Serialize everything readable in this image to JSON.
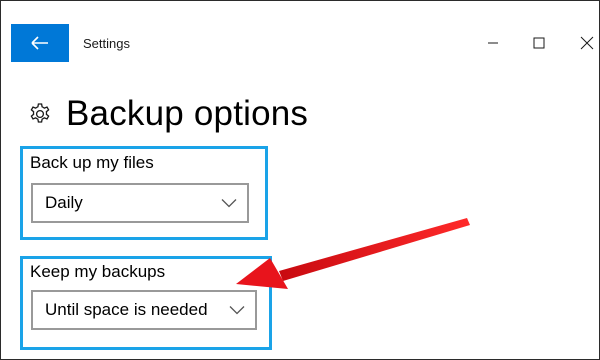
{
  "window": {
    "title": "Settings",
    "back_icon": "back-arrow-icon",
    "accent_color": "#0078d7",
    "controls": [
      "minimize-icon",
      "maximize-icon",
      "close-icon"
    ]
  },
  "page": {
    "title": "Backup options",
    "icon": "gear-icon"
  },
  "settings": {
    "backup_frequency": {
      "label": "Back up my files",
      "value": "Daily"
    },
    "keep_backups": {
      "label": "Keep my backups",
      "value": "Until space is needed"
    }
  },
  "annotations": {
    "highlight_color": "#1aa3e8",
    "arrow_color": "#e8141c"
  }
}
